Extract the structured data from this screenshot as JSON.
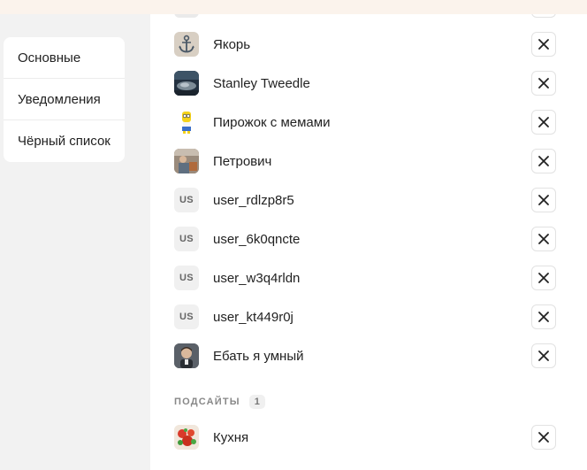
{
  "sidebar": {
    "items": [
      {
        "label": "Основные"
      },
      {
        "label": "Уведомления"
      },
      {
        "label": "Чёрный список"
      }
    ]
  },
  "blacklist": {
    "users": [
      {
        "name": "Якорь",
        "avatar": "anchor-avatar"
      },
      {
        "name": "Stanley Tweedle",
        "avatar": "photo-avatar"
      },
      {
        "name": "Пирожок с мемами",
        "avatar": "cartoon-avatar"
      },
      {
        "name": "Петрович",
        "avatar": "photo-avatar"
      },
      {
        "name": "user_rdlzp8r5",
        "avatar": "initials",
        "initials": "US"
      },
      {
        "name": "user_6k0qncte",
        "avatar": "initials",
        "initials": "US"
      },
      {
        "name": "user_w3q4rldn",
        "avatar": "initials",
        "initials": "US"
      },
      {
        "name": "user_kt449r0j",
        "avatar": "initials",
        "initials": "US"
      },
      {
        "name": "Ебать я умный",
        "avatar": "photo-avatar"
      }
    ],
    "subsites_section": {
      "title": "ПОДСАЙТЫ",
      "count": "1",
      "items": [
        {
          "name": "Кухня",
          "avatar": "food-avatar"
        }
      ]
    },
    "remove_icon": "close-icon"
  },
  "colors": {
    "page_bg": "#f2f2f2",
    "top_strip": "#fbf3ec",
    "card_bg": "#ffffff",
    "text": "#222222",
    "muted": "#888888"
  }
}
